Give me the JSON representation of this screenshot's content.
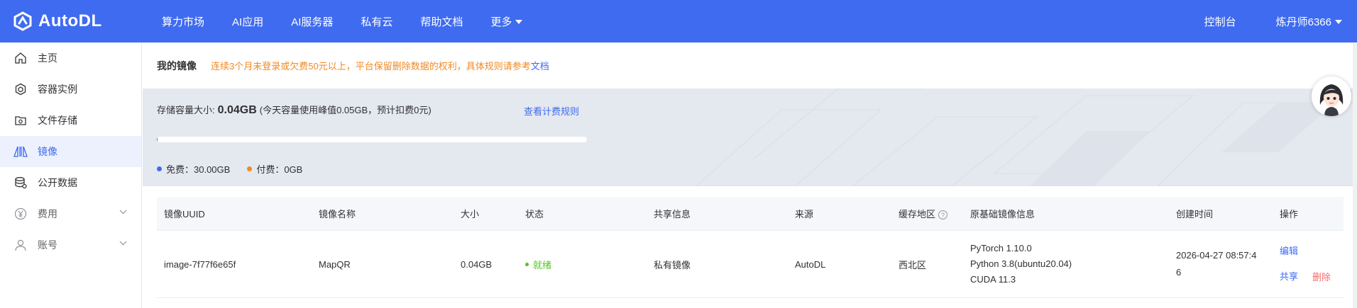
{
  "brand": {
    "name": "AutoDL"
  },
  "nav": {
    "items": [
      "算力市场",
      "AI应用",
      "AI服务器",
      "私有云",
      "帮助文档"
    ],
    "more": "更多"
  },
  "header": {
    "console": "控制台",
    "user": "炼丹师6366"
  },
  "sidebar": {
    "items": [
      {
        "label": "主页",
        "icon": "home-icon"
      },
      {
        "label": "容器实例",
        "icon": "cube-icon"
      },
      {
        "label": "文件存储",
        "icon": "folder-icon"
      },
      {
        "label": "镜像",
        "icon": "image-icon",
        "active": true
      },
      {
        "label": "公开数据",
        "icon": "database-icon"
      },
      {
        "label": "费用",
        "icon": "yen-icon",
        "expandable": true
      },
      {
        "label": "账号",
        "icon": "user-icon",
        "expandable": true
      }
    ]
  },
  "page": {
    "title": "我的镜像",
    "notice": "连续3个月未登录或欠费50元以上，平台保留删除数据的权利，具体规则请参考",
    "notice_link": "文档"
  },
  "storage": {
    "label": "存储容量大小:",
    "size": "0.04GB",
    "sub": "(今天容量使用峰值0.05GB，预计扣费0元)",
    "fee_link": "查看计费规则",
    "used_fraction": 0.001,
    "free": "免费：30.00GB",
    "paid": "付费：0GB",
    "colors": {
      "free": "#3f6bf0",
      "paid": "#f08a24"
    }
  },
  "table": {
    "headers": [
      "镜像UUID",
      "镜像名称",
      "大小",
      "状态",
      "共享信息",
      "来源",
      "缓存地区",
      "原基础镜像信息",
      "创建时间",
      "操作"
    ],
    "rows": [
      {
        "uuid": "image-7f77f6e65f",
        "name": "MapQR",
        "size": "0.04GB",
        "status": "就绪",
        "share": "私有镜像",
        "source": "AutoDL",
        "region": "西北区",
        "base": [
          "PyTorch  1.10.0",
          "Python  3.8(ubuntu20.04)",
          "CUDA  11.3"
        ],
        "created_line1": "2026-04-27 08:57:4",
        "created_line2": "6",
        "ops": {
          "edit": "编辑",
          "share": "共享",
          "delete": "删除"
        }
      }
    ]
  },
  "theme": {
    "primary": "#3f6bf0",
    "success": "#52c41a",
    "warning": "#f08a24",
    "danger": "#f56c6c"
  }
}
